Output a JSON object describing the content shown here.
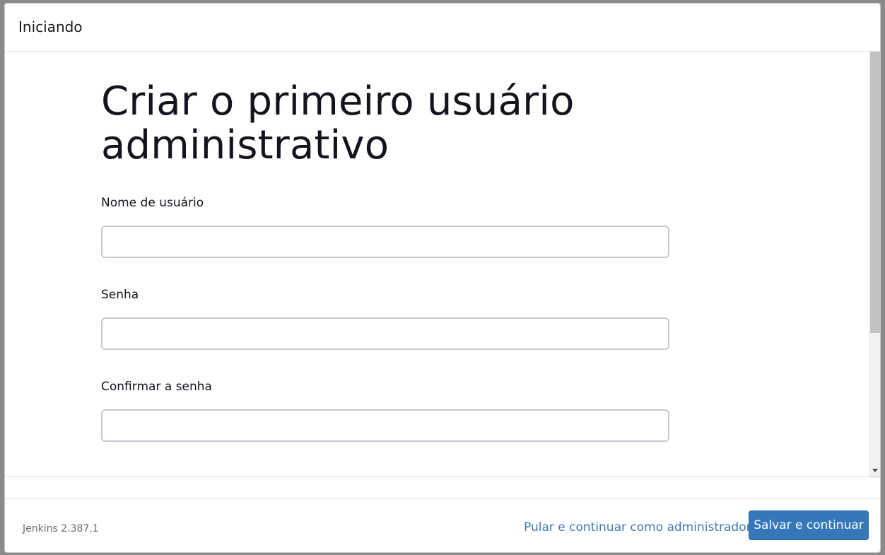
{
  "header": {
    "title": "Iniciando"
  },
  "form": {
    "title": "Criar o primeiro usuário administrativo",
    "fields": [
      {
        "label": "Nome de usuário",
        "value": "",
        "placeholder": ""
      },
      {
        "label": "Senha",
        "value": "",
        "placeholder": ""
      },
      {
        "label": "Confirmar a senha",
        "value": "",
        "placeholder": ""
      }
    ]
  },
  "footer": {
    "version": "Jenkins 2.387.1",
    "skip_label": "Pular e continuar como administrador",
    "save_label": "Salvar e continuar"
  },
  "colors": {
    "accent": "#3578ba",
    "link": "#3d7ab7"
  }
}
